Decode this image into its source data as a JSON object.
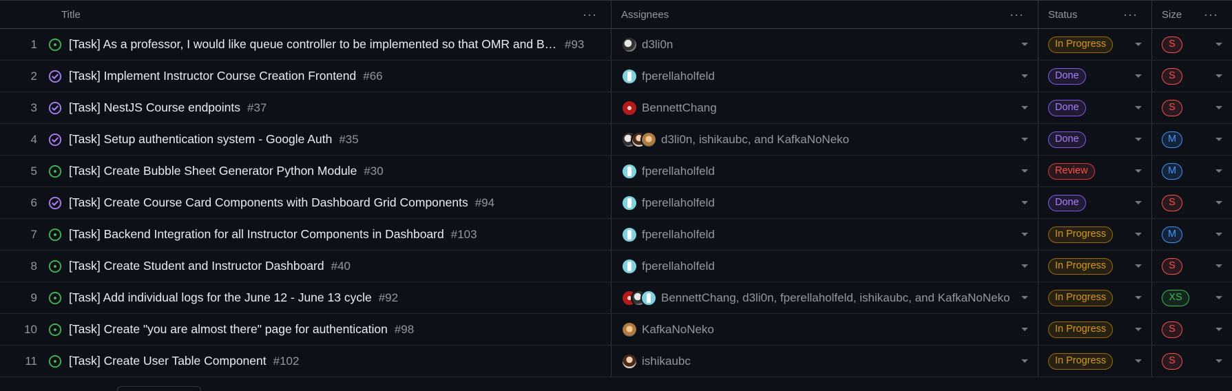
{
  "columns": {
    "title": "Title",
    "assignees": "Assignees",
    "status": "Status",
    "size": "Size",
    "menu_glyph": "···"
  },
  "rows": [
    {
      "n": "1",
      "state": "open",
      "title": "[Task] As a professor, I would like queue controller to be implemented so that OMR and Bu...",
      "issue": "#93",
      "avatars": [
        "d3"
      ],
      "assignees": "d3li0n",
      "status": "In Progress",
      "size": "S"
    },
    {
      "n": "2",
      "state": "closed",
      "title": "[Task] Implement Instructor Course Creation Frontend",
      "issue": "#66",
      "avatars": [
        "fp"
      ],
      "assignees": "fperellaholfeld",
      "status": "Done",
      "size": "S"
    },
    {
      "n": "3",
      "state": "closed",
      "title": "[Task] NestJS Course endpoints",
      "issue": "#37",
      "avatars": [
        "bc"
      ],
      "assignees": "BennettChang",
      "status": "Done",
      "size": "S"
    },
    {
      "n": "4",
      "state": "closed",
      "title": "[Task] Setup authentication system - Google Auth",
      "issue": "#35",
      "avatars": [
        "d3",
        "ish",
        "kk"
      ],
      "assignees": "d3li0n, ishikaubc, and KafkaNoNeko",
      "status": "Done",
      "size": "M"
    },
    {
      "n": "5",
      "state": "open",
      "title": "[Task] Create Bubble Sheet Generator Python Module",
      "issue": "#30",
      "avatars": [
        "fp"
      ],
      "assignees": "fperellaholfeld",
      "status": "Review",
      "size": "M"
    },
    {
      "n": "6",
      "state": "closed",
      "title": "[Task] Create Course Card Components with Dashboard Grid Components",
      "issue": "#94",
      "avatars": [
        "fp"
      ],
      "assignees": "fperellaholfeld",
      "status": "Done",
      "size": "S"
    },
    {
      "n": "7",
      "state": "open",
      "title": "[Task] Backend Integration for all Instructor Components in Dashboard",
      "issue": "#103",
      "avatars": [
        "fp"
      ],
      "assignees": "fperellaholfeld",
      "status": "In Progress",
      "size": "M"
    },
    {
      "n": "8",
      "state": "open",
      "title": "[Task] Create Student and Instructor Dashboard",
      "issue": "#40",
      "avatars": [
        "fp"
      ],
      "assignees": "fperellaholfeld",
      "status": "In Progress",
      "size": "S"
    },
    {
      "n": "9",
      "state": "open",
      "title": "[Task] Add individual logs for the June 12 - June 13 cycle",
      "issue": "#92",
      "avatars": [
        "bc",
        "d3",
        "fp"
      ],
      "assignees": "BennettChang, d3li0n, fperellaholfeld, ishikaubc, and KafkaNoNeko",
      "status": "In Progress",
      "size": "XS"
    },
    {
      "n": "10",
      "state": "open",
      "title": "[Task] Create \"you are almost there\" page for authentication",
      "issue": "#98",
      "avatars": [
        "kk"
      ],
      "assignees": "KafkaNoNeko",
      "status": "In Progress",
      "size": "S"
    },
    {
      "n": "11",
      "state": "open",
      "title": "[Task] Create User Table Component",
      "issue": "#102",
      "avatars": [
        "ish"
      ],
      "assignees": "ishikaubc",
      "status": "In Progress",
      "size": "S"
    }
  ],
  "colors": {
    "background": "#0d1117",
    "open_icon": "#3fb950",
    "closed_icon": "#ab7df8",
    "in_progress": "#d29922",
    "done": "#ab7df8",
    "review": "#f85149",
    "size_s": "#f85149",
    "size_m": "#4493f8",
    "size_xs": "#3fb950"
  },
  "icons": {
    "open": "issue-open-icon",
    "closed": "issue-closed-icon",
    "column_menu": "kebab-menu-icon",
    "dropdown": "caret-down-icon"
  }
}
